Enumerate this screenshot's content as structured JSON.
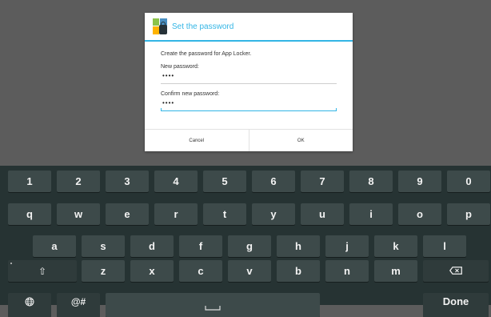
{
  "dialog": {
    "title": "Set the password",
    "message": "Create the password for App Locker.",
    "new_password_label": "New password:",
    "new_password_value": "••••",
    "confirm_password_label": "Confirm new password:",
    "confirm_password_value": "••••",
    "cancel_label": "Cancel",
    "ok_label": "OK",
    "icon": "app-locker-icon"
  },
  "keyboard": {
    "row1": [
      "1",
      "2",
      "3",
      "4",
      "5",
      "6",
      "7",
      "8",
      "9",
      "0"
    ],
    "row2": [
      "q",
      "w",
      "e",
      "r",
      "t",
      "y",
      "u",
      "i",
      "o",
      "p"
    ],
    "row3": [
      "a",
      "s",
      "d",
      "f",
      "g",
      "h",
      "j",
      "k",
      "l"
    ],
    "row4": [
      "z",
      "x",
      "c",
      "v",
      "b",
      "n",
      "m"
    ],
    "shift_icon": "⇧",
    "symbols_label": "@#",
    "globe_icon": "globe-icon",
    "space_icon": "space-icon",
    "backspace_icon": "backspace-icon",
    "done_label": "Done"
  },
  "colors": {
    "accent": "#33b5e5",
    "keyboard_bg": "#263333",
    "key_bg": "#3d4a4a",
    "dim_bg": "#5c5c5c"
  }
}
